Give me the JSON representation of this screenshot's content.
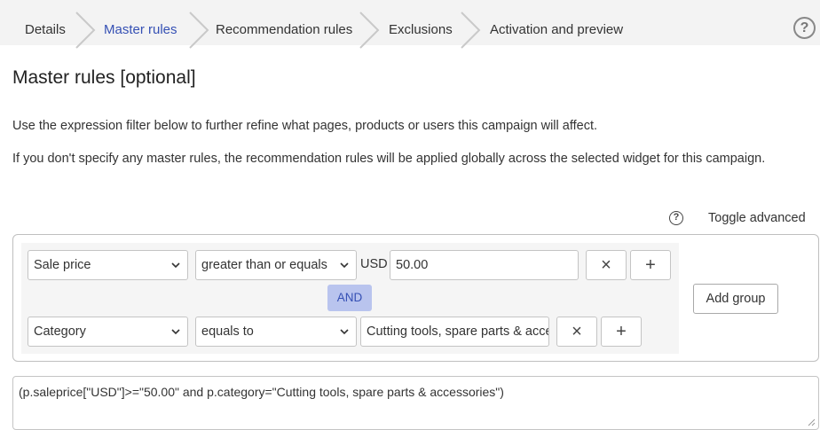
{
  "steps": [
    {
      "label": "Details",
      "active": false
    },
    {
      "label": "Master rules",
      "active": true
    },
    {
      "label": "Recommendation rules",
      "active": false
    },
    {
      "label": "Exclusions",
      "active": false
    },
    {
      "label": "Activation and preview",
      "active": false
    }
  ],
  "help_icon": "?",
  "page_title": "Master rules [optional]",
  "description_1": "Use the expression filter below to further refine what pages, products or users this campaign will affect.",
  "description_2": "If you don't specify any master rules, the recommendation rules will be applied globally across the selected widget for this campaign.",
  "toggle_help_icon": "?",
  "toggle_advanced_label": "Toggle advanced",
  "rules": [
    {
      "attribute": "Sale price",
      "operator": "greater than or equals",
      "currency": "USD",
      "value": "50.00",
      "remove_icon": "×",
      "add_icon": "+"
    },
    {
      "attribute": "Category",
      "operator": "equals to",
      "value": "Cutting tools, spare parts & accessories",
      "remove_icon": "×",
      "add_icon": "+"
    }
  ],
  "connector": "AND",
  "add_group_label": "Add group",
  "expression": "(p.saleprice[\"USD\"]>=\"50.00\" and p.category=\"Cutting tools, spare parts & accessories\")",
  "colors": {
    "active_step": "#3550b4",
    "and_badge_bg": "#b9c4ee",
    "steps_bar_bg": "#f3f3f3"
  }
}
